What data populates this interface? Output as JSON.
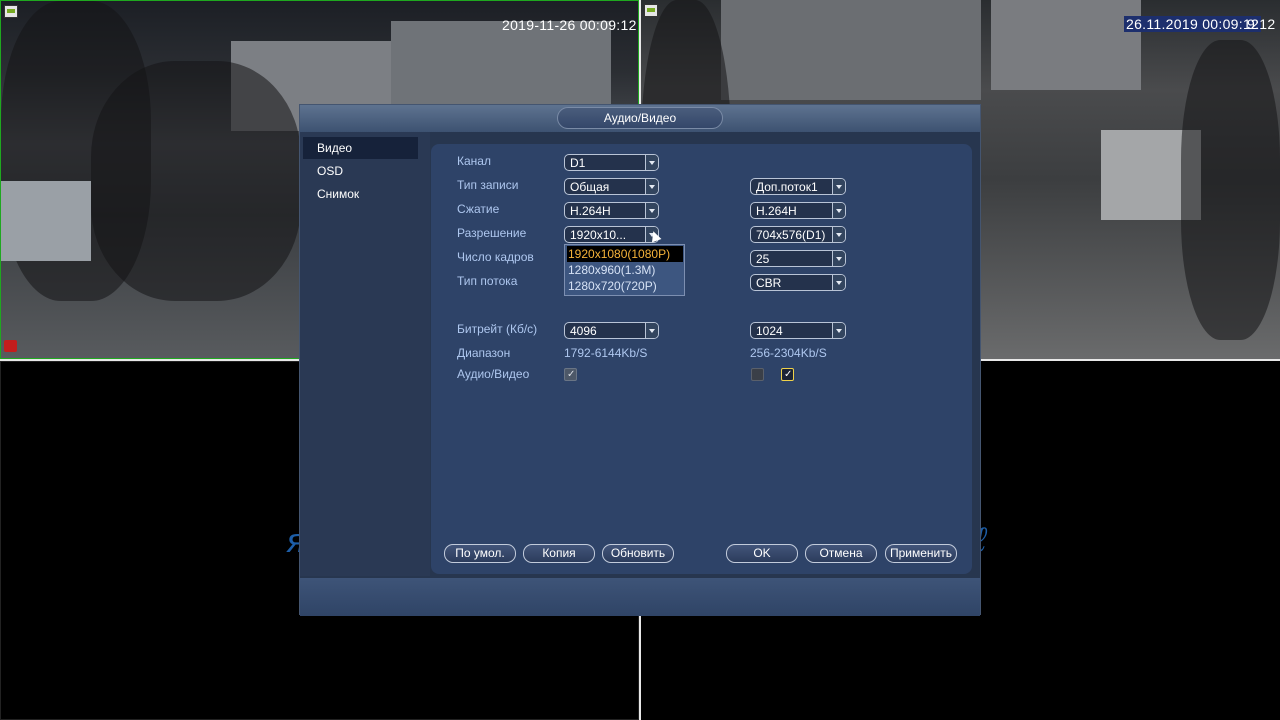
{
  "cameras": {
    "cam1": {
      "timestamp": "2019-11-26 00:09:12"
    },
    "cam2": {
      "timestamp": "26.11.2019 00:09:12",
      "timestamp_tail": "9:12"
    }
  },
  "dialog": {
    "title": "Аудио/Видео",
    "sidebar": [
      "Видео",
      "OSD",
      "Снимок"
    ],
    "fields": {
      "channel": {
        "label": "Канал",
        "value": "D1"
      },
      "record_type": {
        "label": "Тип записи",
        "main": "Общая",
        "sub": "Доп.поток1"
      },
      "compression": {
        "label": "Сжатие",
        "main": "H.264H",
        "sub": "H.264H"
      },
      "resolution": {
        "label": "Разрешение",
        "main": "1920x10...",
        "sub": "704x576(D1)"
      },
      "frame_rate": {
        "label": "Число кадров",
        "sub": "25"
      },
      "stream_type": {
        "label": "Тип потока",
        "sub": "CBR"
      },
      "bitrate": {
        "label": "Битрейт (Кб/с)",
        "main": "4096",
        "sub": "1024"
      },
      "range": {
        "label": "Диапазон",
        "main": "1792-6144Kb/S",
        "sub": "256-2304Kb/S"
      },
      "audio_video": {
        "label": "Аудио/Видео"
      }
    },
    "resolution_options": [
      "1920x1080(1080P)",
      "1280x960(1.3M)",
      "1280x720(720P)"
    ],
    "buttons": {
      "default": "По умол.",
      "copy": "Копия",
      "refresh": "Обновить",
      "ok": "OK",
      "cancel": "Отмена",
      "apply": "Применить"
    }
  },
  "colors": {
    "accent": "#f6b33a",
    "label": "#aec7ef",
    "panel": "#2e4368"
  }
}
